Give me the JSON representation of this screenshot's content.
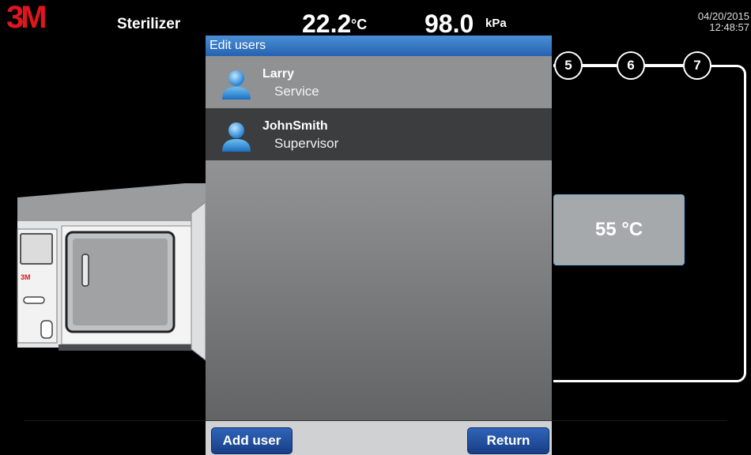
{
  "header": {
    "logo_text": "3M",
    "device_name": "Sterilizer",
    "temperature_value": "22.2",
    "temperature_unit": "°C",
    "pressure_value": "98.0",
    "pressure_unit": "kPa",
    "date": "04/20/2015",
    "time": "12:48:57"
  },
  "cycle": {
    "steps": [
      "5",
      "6",
      "7"
    ],
    "temperature_setpoint": "55 °C"
  },
  "sterilizer_illustration": {
    "logo_text": "3M"
  },
  "dialog": {
    "title": "Edit users",
    "users": [
      {
        "name": "Larry",
        "role": "Service"
      },
      {
        "name": "JohnSmith",
        "role": "Supervisor"
      }
    ],
    "add_user_label": "Add user",
    "return_label": "Return"
  },
  "colors": {
    "brand_red": "#e0161e",
    "title_bar_blue": "#2f73c4",
    "button_blue": "#2353a3",
    "selected_row": "#3b3d3f"
  }
}
